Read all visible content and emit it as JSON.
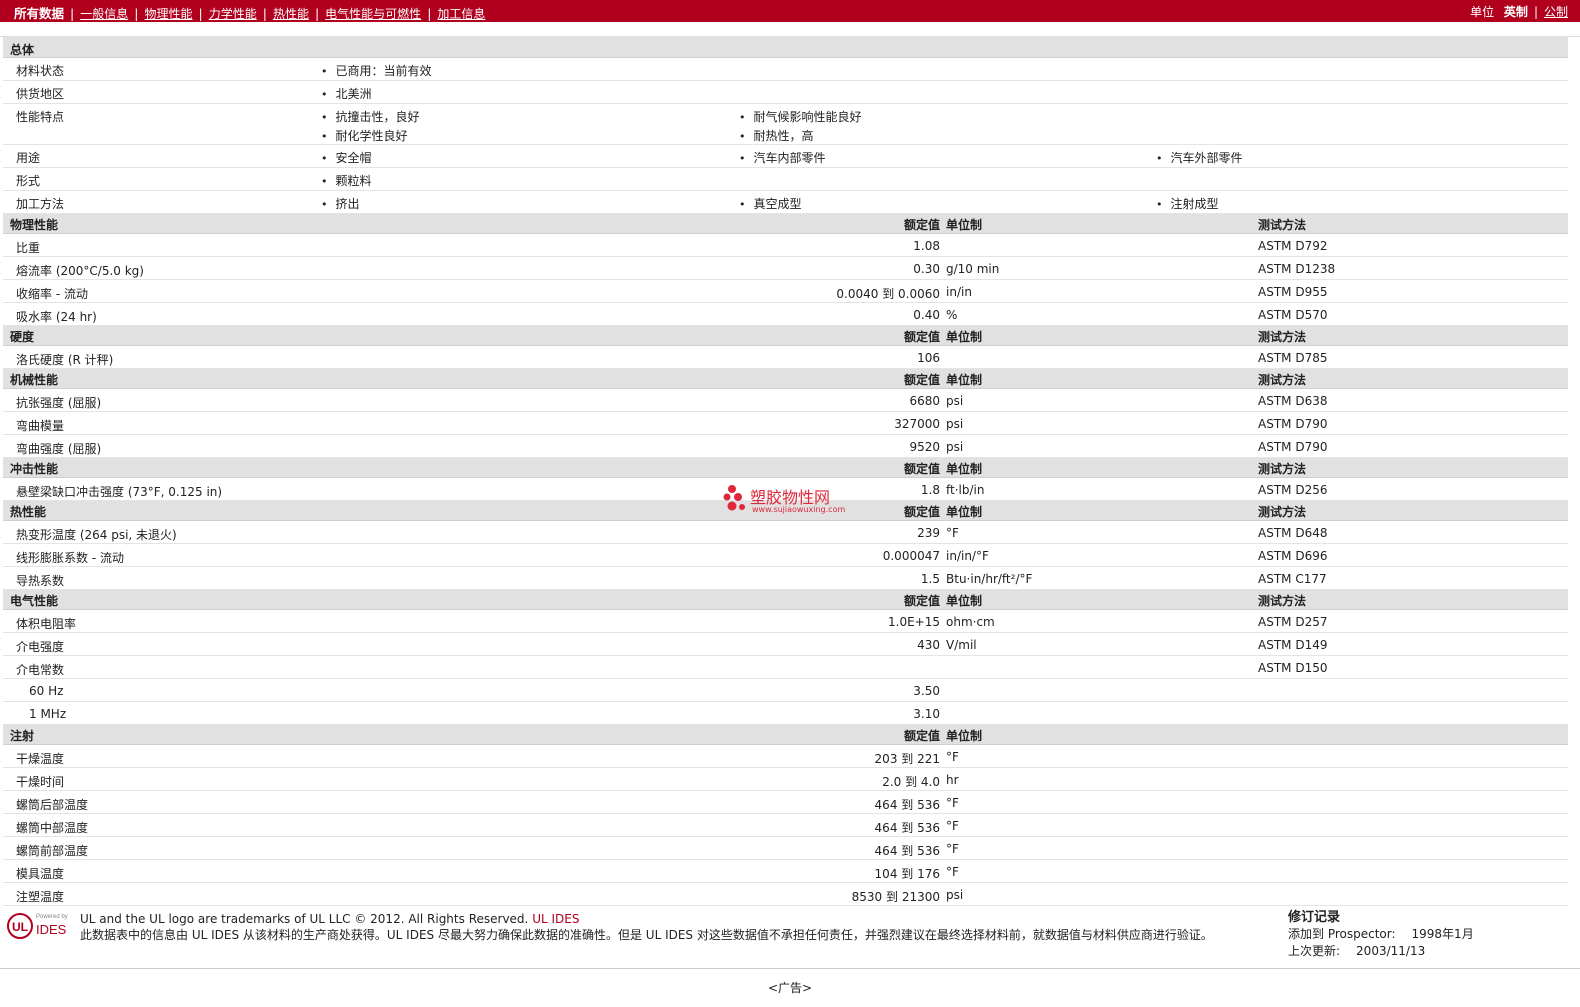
{
  "nav": {
    "items": [
      "所有数据",
      "一般信息",
      "物理性能",
      "力学性能",
      "热性能",
      "电气性能与可燃性",
      "加工信息"
    ],
    "units_label": "单位",
    "units_options": [
      "英制",
      "公制"
    ]
  },
  "general": {
    "title": "总体",
    "material_status_label": "材料状态",
    "material_status": [
      "已商用：当前有效"
    ],
    "region_label": "供货地区",
    "region": [
      "北美洲"
    ],
    "features_label": "性能特点",
    "features": [
      "抗撞击性，良好",
      "耐气候影响性能良好",
      "耐化学性良好",
      "耐热性，高"
    ],
    "uses_label": "用途",
    "uses": [
      "安全帽",
      "汽车内部零件",
      "汽车外部零件"
    ],
    "form_label": "形式",
    "form": [
      "颗粒料"
    ],
    "process_label": "加工方法",
    "process": [
      "挤出",
      "真空成型",
      "注射成型"
    ]
  },
  "col_heads": {
    "value": "额定值",
    "unit": "单位制",
    "test": "测试方法"
  },
  "sections": [
    {
      "title": "物理性能",
      "rows": [
        {
          "name": "比重",
          "value": "1.08",
          "unit": "",
          "test": "ASTM D792"
        },
        {
          "name": "熔流率 (200°C/5.0 kg)",
          "value": "0.30",
          "unit": "g/10 min",
          "test": "ASTM D1238"
        },
        {
          "name": "收缩率 - 流动",
          "value": "0.0040 到  0.0060",
          "unit": "in/in",
          "test": "ASTM D955"
        },
        {
          "name": "吸水率 (24 hr)",
          "value": "0.40",
          "unit": "%",
          "test": "ASTM D570"
        }
      ]
    },
    {
      "title": "硬度",
      "rows": [
        {
          "name": "洛氏硬度 (R 计秤)",
          "value": "106",
          "unit": "",
          "test": "ASTM D785"
        }
      ]
    },
    {
      "title": "机械性能",
      "rows": [
        {
          "name": "抗张强度 (屈服)",
          "value": "6680",
          "unit": "psi",
          "test": "ASTM D638"
        },
        {
          "name": "弯曲模量",
          "value": "327000",
          "unit": "psi",
          "test": "ASTM D790"
        },
        {
          "name": "弯曲强度 (屈服)",
          "value": "9520",
          "unit": "psi",
          "test": "ASTM D790"
        }
      ]
    },
    {
      "title": "冲击性能",
      "rows": [
        {
          "name": "悬壁梁缺口冲击强度 (73°F, 0.125 in)",
          "value": "1.8",
          "unit": "ft·lb/in",
          "test": "ASTM D256"
        }
      ]
    },
    {
      "title": "热性能",
      "rows": [
        {
          "name": "热变形温度 (264 psi, 未退火)",
          "value": "239",
          "unit": "°F",
          "test": "ASTM D648"
        },
        {
          "name": "线形膨胀系数 - 流动",
          "value": "0.000047",
          "unit": "in/in/°F",
          "test": "ASTM D696"
        },
        {
          "name": "导热系数",
          "value": "1.5",
          "unit": "Btu·in/hr/ft²/°F",
          "test": "ASTM C177"
        }
      ]
    },
    {
      "title": "电气性能",
      "rows": [
        {
          "name": "体积电阻率",
          "value": "1.0E+15",
          "unit": "ohm·cm",
          "test": "ASTM D257"
        },
        {
          "name": "介电强度",
          "value": "430",
          "unit": "V/mil",
          "test": "ASTM D149"
        },
        {
          "name": "介电常数",
          "value": "",
          "unit": "",
          "test": "ASTM D150"
        },
        {
          "name": "60 Hz",
          "value": "3.50",
          "unit": "",
          "test": "",
          "sub": true
        },
        {
          "name": "1 MHz",
          "value": "3.10",
          "unit": "",
          "test": "",
          "sub": true
        }
      ]
    },
    {
      "title": "注射",
      "no_test": true,
      "rows": [
        {
          "name": "干燥温度",
          "value": "203 到  221",
          "unit": "°F",
          "test": ""
        },
        {
          "name": "干燥时间",
          "value": "2.0 到  4.0",
          "unit": "hr",
          "test": ""
        },
        {
          "name": "螺筒后部温度",
          "value": "464 到  536",
          "unit": "°F",
          "test": ""
        },
        {
          "name": "螺筒中部温度",
          "value": "464 到  536",
          "unit": "°F",
          "test": ""
        },
        {
          "name": "螺筒前部温度",
          "value": "464 到  536",
          "unit": "°F",
          "test": ""
        },
        {
          "name": "模具温度",
          "value": "104 到  176",
          "unit": "°F",
          "test": ""
        },
        {
          "name": "注塑温度",
          "value": "8530 到  21300",
          "unit": "psi",
          "test": ""
        }
      ]
    }
  ],
  "watermark": {
    "name": "塑胶物性网",
    "url": "www.sujiaowuxing.com"
  },
  "footer": {
    "logo_powered": "Powered by",
    "logo_ul": "UL",
    "logo_ides": "IDES",
    "trademark": "UL and the UL logo are trademarks of UL LLC © 2012. All Rights Reserved.",
    "trademark_link": "UL IDES",
    "disclaimer": "此数据表中的信息由  UL IDES 从该材料的生产商处获得。UL IDES 尽最大努力确保此数据的准确性。但是  UL IDES 对这些数据值不承担任何责任，并强烈建议在最终选择材料前，就数据值与材料供应商进行验证。",
    "rev_title": "修订记录",
    "added_label": "添加到  Prospector:",
    "added_value": "1998年1月",
    "updated_label": "上次更新:",
    "updated_value": "2003/11/13",
    "ad": "<广告>"
  },
  "colors": {
    "brand": "#b0001e",
    "section_bg": "#e1e1e1"
  }
}
